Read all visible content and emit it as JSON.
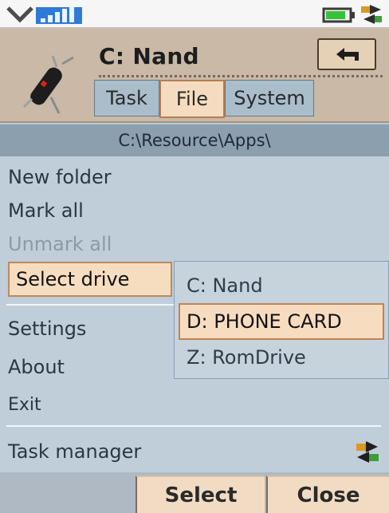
{
  "header": {
    "title": "C: Nand",
    "app_icon": "swiss-knife-icon",
    "back_icon": "back-arrow-icon",
    "tabs": [
      {
        "label": "Task"
      },
      {
        "label": "File"
      },
      {
        "label": "System"
      }
    ],
    "active_tab": "File"
  },
  "status_bar": {
    "left_icons": [
      "dropdown-chevron-icon",
      "signal-strength-icon"
    ],
    "right_icons": [
      "battery-icon",
      "network-sync-icon"
    ]
  },
  "path_bar": {
    "path": "C:\\Resource\\Apps\\"
  },
  "menu": {
    "items": [
      {
        "label": "New folder"
      },
      {
        "label": "Mark all"
      },
      {
        "label": "Unmark all",
        "disabled": true
      },
      {
        "label": "Select drive",
        "selected": true
      },
      {
        "label": "Settings"
      },
      {
        "label": "About"
      },
      {
        "label": "Exit"
      },
      {
        "label": "Task manager",
        "icon": "task-manager-icon"
      }
    ]
  },
  "submenu": {
    "items": [
      {
        "label": "C: Nand"
      },
      {
        "label": "D: PHONE CARD",
        "selected": true
      },
      {
        "label": "Z: RomDrive"
      }
    ]
  },
  "softkeys": {
    "left": "Select",
    "right": "Close"
  },
  "colors": {
    "header_bg": "#c9b9a6",
    "path_bg": "#8c9faf",
    "menu_bg": "#c0ced9",
    "highlight": "#f7ddc0",
    "highlight_border": "#bd8a5d",
    "signal_blue": "#3d8ee8",
    "battery_green": "#39c040"
  }
}
